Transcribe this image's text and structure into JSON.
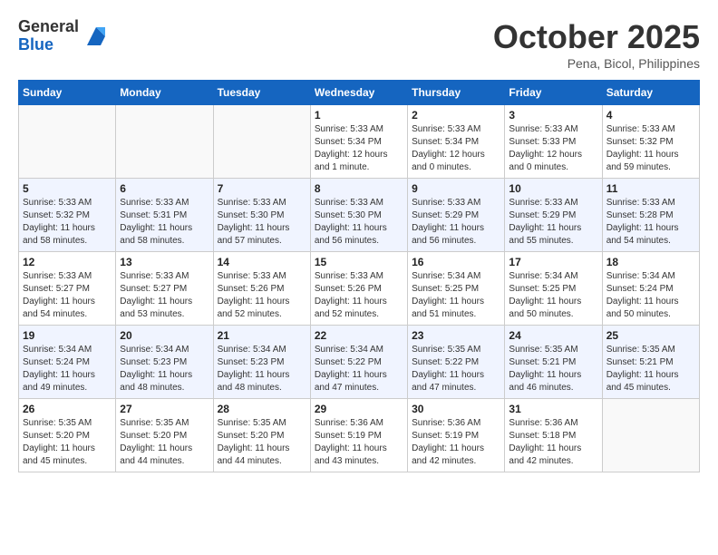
{
  "header": {
    "logo_general": "General",
    "logo_blue": "Blue",
    "month_title": "October 2025",
    "location": "Pena, Bicol, Philippines"
  },
  "weekdays": [
    "Sunday",
    "Monday",
    "Tuesday",
    "Wednesday",
    "Thursday",
    "Friday",
    "Saturday"
  ],
  "weeks": [
    [
      {
        "day": "",
        "info": ""
      },
      {
        "day": "",
        "info": ""
      },
      {
        "day": "",
        "info": ""
      },
      {
        "day": "1",
        "info": "Sunrise: 5:33 AM\nSunset: 5:34 PM\nDaylight: 12 hours\nand 1 minute."
      },
      {
        "day": "2",
        "info": "Sunrise: 5:33 AM\nSunset: 5:34 PM\nDaylight: 12 hours\nand 0 minutes."
      },
      {
        "day": "3",
        "info": "Sunrise: 5:33 AM\nSunset: 5:33 PM\nDaylight: 12 hours\nand 0 minutes."
      },
      {
        "day": "4",
        "info": "Sunrise: 5:33 AM\nSunset: 5:32 PM\nDaylight: 11 hours\nand 59 minutes."
      }
    ],
    [
      {
        "day": "5",
        "info": "Sunrise: 5:33 AM\nSunset: 5:32 PM\nDaylight: 11 hours\nand 58 minutes."
      },
      {
        "day": "6",
        "info": "Sunrise: 5:33 AM\nSunset: 5:31 PM\nDaylight: 11 hours\nand 58 minutes."
      },
      {
        "day": "7",
        "info": "Sunrise: 5:33 AM\nSunset: 5:30 PM\nDaylight: 11 hours\nand 57 minutes."
      },
      {
        "day": "8",
        "info": "Sunrise: 5:33 AM\nSunset: 5:30 PM\nDaylight: 11 hours\nand 56 minutes."
      },
      {
        "day": "9",
        "info": "Sunrise: 5:33 AM\nSunset: 5:29 PM\nDaylight: 11 hours\nand 56 minutes."
      },
      {
        "day": "10",
        "info": "Sunrise: 5:33 AM\nSunset: 5:29 PM\nDaylight: 11 hours\nand 55 minutes."
      },
      {
        "day": "11",
        "info": "Sunrise: 5:33 AM\nSunset: 5:28 PM\nDaylight: 11 hours\nand 54 minutes."
      }
    ],
    [
      {
        "day": "12",
        "info": "Sunrise: 5:33 AM\nSunset: 5:27 PM\nDaylight: 11 hours\nand 54 minutes."
      },
      {
        "day": "13",
        "info": "Sunrise: 5:33 AM\nSunset: 5:27 PM\nDaylight: 11 hours\nand 53 minutes."
      },
      {
        "day": "14",
        "info": "Sunrise: 5:33 AM\nSunset: 5:26 PM\nDaylight: 11 hours\nand 52 minutes."
      },
      {
        "day": "15",
        "info": "Sunrise: 5:33 AM\nSunset: 5:26 PM\nDaylight: 11 hours\nand 52 minutes."
      },
      {
        "day": "16",
        "info": "Sunrise: 5:34 AM\nSunset: 5:25 PM\nDaylight: 11 hours\nand 51 minutes."
      },
      {
        "day": "17",
        "info": "Sunrise: 5:34 AM\nSunset: 5:25 PM\nDaylight: 11 hours\nand 50 minutes."
      },
      {
        "day": "18",
        "info": "Sunrise: 5:34 AM\nSunset: 5:24 PM\nDaylight: 11 hours\nand 50 minutes."
      }
    ],
    [
      {
        "day": "19",
        "info": "Sunrise: 5:34 AM\nSunset: 5:24 PM\nDaylight: 11 hours\nand 49 minutes."
      },
      {
        "day": "20",
        "info": "Sunrise: 5:34 AM\nSunset: 5:23 PM\nDaylight: 11 hours\nand 48 minutes."
      },
      {
        "day": "21",
        "info": "Sunrise: 5:34 AM\nSunset: 5:23 PM\nDaylight: 11 hours\nand 48 minutes."
      },
      {
        "day": "22",
        "info": "Sunrise: 5:34 AM\nSunset: 5:22 PM\nDaylight: 11 hours\nand 47 minutes."
      },
      {
        "day": "23",
        "info": "Sunrise: 5:35 AM\nSunset: 5:22 PM\nDaylight: 11 hours\nand 47 minutes."
      },
      {
        "day": "24",
        "info": "Sunrise: 5:35 AM\nSunset: 5:21 PM\nDaylight: 11 hours\nand 46 minutes."
      },
      {
        "day": "25",
        "info": "Sunrise: 5:35 AM\nSunset: 5:21 PM\nDaylight: 11 hours\nand 45 minutes."
      }
    ],
    [
      {
        "day": "26",
        "info": "Sunrise: 5:35 AM\nSunset: 5:20 PM\nDaylight: 11 hours\nand 45 minutes."
      },
      {
        "day": "27",
        "info": "Sunrise: 5:35 AM\nSunset: 5:20 PM\nDaylight: 11 hours\nand 44 minutes."
      },
      {
        "day": "28",
        "info": "Sunrise: 5:35 AM\nSunset: 5:20 PM\nDaylight: 11 hours\nand 44 minutes."
      },
      {
        "day": "29",
        "info": "Sunrise: 5:36 AM\nSunset: 5:19 PM\nDaylight: 11 hours\nand 43 minutes."
      },
      {
        "day": "30",
        "info": "Sunrise: 5:36 AM\nSunset: 5:19 PM\nDaylight: 11 hours\nand 42 minutes."
      },
      {
        "day": "31",
        "info": "Sunrise: 5:36 AM\nSunset: 5:18 PM\nDaylight: 11 hours\nand 42 minutes."
      },
      {
        "day": "",
        "info": ""
      }
    ]
  ]
}
